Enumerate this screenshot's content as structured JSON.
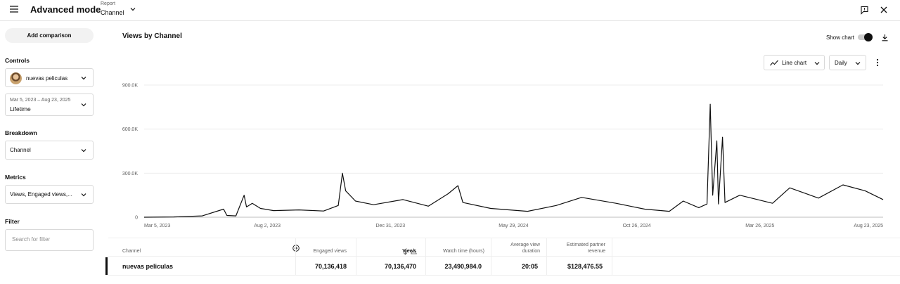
{
  "header": {
    "title": "Advanced mode",
    "report_label": "Report",
    "report_value": "Channel"
  },
  "sidebar": {
    "add_comparison": "Add comparison",
    "controls_label": "Controls",
    "channel_name": "nuevas peliculas",
    "date_range": "Mar 5, 2023 – Aug 23, 2025",
    "date_preset": "Lifetime",
    "breakdown_label": "Breakdown",
    "breakdown_value": "Channel",
    "metrics_label": "Metrics",
    "metrics_value": "Views, Engaged views,...",
    "filter_label": "Filter",
    "filter_placeholder": "Search for filter"
  },
  "chart_header": {
    "title": "Views by Channel",
    "show_chart_label": "Show chart",
    "chart_type": "Line chart",
    "interval": "Daily"
  },
  "chart_data": {
    "type": "line",
    "title": "Views by Channel",
    "x_range": [
      "2023-03-05",
      "2025-08-23"
    ],
    "ylim": [
      0,
      900000
    ],
    "y_ticks": [
      "0",
      "300.0K",
      "600.0K",
      "900.0K"
    ],
    "x_ticks": [
      "Mar 5, 2023",
      "Aug 2, 2023",
      "Dec 31, 2023",
      "May 29, 2024",
      "Oct 26, 2024",
      "Mar 26, 2025",
      "Aug 23, 2025"
    ],
    "grid": true,
    "series": [
      {
        "points": [
          [
            "2023-03-05",
            0
          ],
          [
            "2023-04-10",
            2000
          ],
          [
            "2023-05-15",
            9000
          ],
          [
            "2023-06-10",
            55000
          ],
          [
            "2023-06-14",
            12000
          ],
          [
            "2023-06-25",
            9000
          ],
          [
            "2023-07-05",
            150000
          ],
          [
            "2023-07-08",
            70000
          ],
          [
            "2023-07-15",
            95000
          ],
          [
            "2023-07-25",
            60000
          ],
          [
            "2023-08-10",
            45000
          ],
          [
            "2023-09-10",
            50000
          ],
          [
            "2023-10-10",
            42000
          ],
          [
            "2023-10-28",
            80000
          ],
          [
            "2023-11-02",
            300000
          ],
          [
            "2023-11-06",
            180000
          ],
          [
            "2023-11-18",
            110000
          ],
          [
            "2023-12-10",
            85000
          ],
          [
            "2024-01-15",
            120000
          ],
          [
            "2024-02-15",
            75000
          ],
          [
            "2024-03-10",
            160000
          ],
          [
            "2024-03-22",
            215000
          ],
          [
            "2024-03-28",
            100000
          ],
          [
            "2024-05-01",
            60000
          ],
          [
            "2024-06-15",
            40000
          ],
          [
            "2024-07-20",
            80000
          ],
          [
            "2024-08-20",
            135000
          ],
          [
            "2024-10-01",
            95000
          ],
          [
            "2024-11-05",
            55000
          ],
          [
            "2024-12-05",
            40000
          ],
          [
            "2024-12-22",
            110000
          ],
          [
            "2025-01-10",
            65000
          ],
          [
            "2025-01-20",
            90000
          ],
          [
            "2025-01-24",
            770000
          ],
          [
            "2025-01-27",
            150000
          ],
          [
            "2025-02-01",
            520000
          ],
          [
            "2025-02-03",
            90000
          ],
          [
            "2025-02-08",
            545000
          ],
          [
            "2025-02-11",
            100000
          ],
          [
            "2025-03-01",
            150000
          ],
          [
            "2025-04-10",
            95000
          ],
          [
            "2025-05-01",
            200000
          ],
          [
            "2025-06-05",
            130000
          ],
          [
            "2025-07-05",
            220000
          ],
          [
            "2025-08-01",
            180000
          ],
          [
            "2025-08-23",
            120000
          ]
        ]
      }
    ]
  },
  "table": {
    "headers": {
      "channel": "Channel",
      "engaged": "Engaged views",
      "views": "Views",
      "watch_time": "Watch time (hours)",
      "avg_duration_1": "Average view",
      "avg_duration_2": "duration",
      "revenue_1": "Estimated partner",
      "revenue_2": "revenue"
    },
    "row": {
      "channel": "nuevas peliculas",
      "engaged": "70,136,418",
      "views": "70,136,470",
      "watch_time": "23,490,984.0",
      "avg_duration": "20:05",
      "revenue": "$128,476.55"
    }
  }
}
